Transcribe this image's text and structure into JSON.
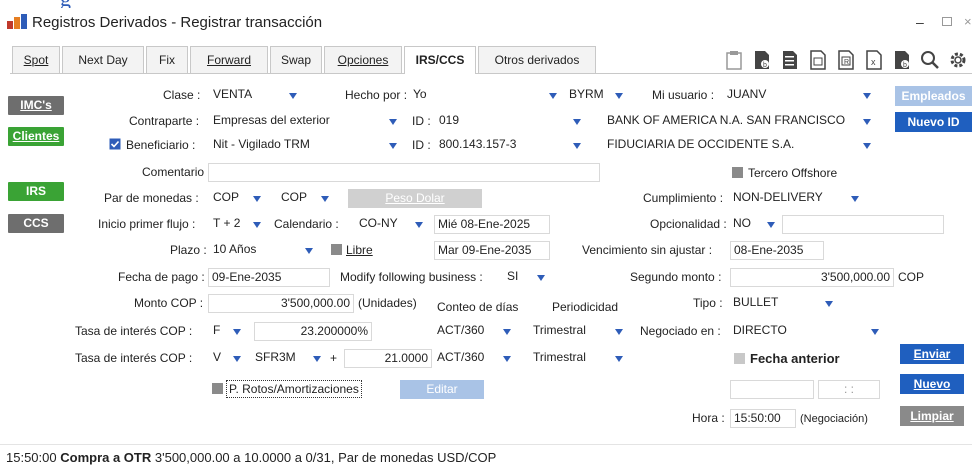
{
  "window": {
    "title": "Registros Derivados - Registrar transacción"
  },
  "tabs": [
    {
      "label": "Spot"
    },
    {
      "label": "Next Day"
    },
    {
      "label": "Fix"
    },
    {
      "label": "Forward"
    },
    {
      "label": "Swap"
    },
    {
      "label": "Opciones"
    },
    {
      "label": "IRS/CCS"
    },
    {
      "label": "Otros derivados"
    }
  ],
  "side": {
    "imcs": "IMC's",
    "clientes": "Clientes",
    "irs": "IRS",
    "ccs": "CCS"
  },
  "form": {
    "clase_label": "Clase :",
    "clase": "VENTA",
    "hecho_por_label": "Hecho por :",
    "hecho_por": "Yo",
    "hecho_por_code": "BYRM",
    "mi_usuario_label": "Mi usuario :",
    "mi_usuario": "JUANV",
    "contraparte_label": "Contraparte :",
    "contraparte": "Empresas del exterior",
    "id1_label": "ID :",
    "id1": "019",
    "contraparte_name": "BANK OF AMERICA N.A. SAN FRANCISCO",
    "beneficiario_label": "Beneficiario :",
    "beneficiario": "Nit - Vigilado TRM",
    "id2_label": "ID :",
    "id2": "800.143.157-3",
    "beneficiario_name": "FIDUCIARIA DE OCCIDENTE S.A.",
    "comentario_label": "Comentario :",
    "comentario": "",
    "tercero_label": "Tercero Offshore",
    "par_label": "Par de monedas :",
    "par1": "COP",
    "par2": "COP",
    "peso_dolar": "Peso Dolar",
    "cumplimiento_label": "Cumplimiento :",
    "cumplimiento": "NON-DELIVERY",
    "inicio_label": "Inicio primer flujo :",
    "inicio": "T + 2",
    "calendario_label": "Calendario :",
    "calendario": "CO-NY",
    "calendario_date": "Mié 08-Ene-2025",
    "opcionalidad_label": "Opcionalidad :",
    "opcionalidad": "NO",
    "plazo_label": "Plazo :",
    "plazo": "10 Años",
    "libre_label": "Libre",
    "plazo_date": "Mar 09-Ene-2035",
    "venc_label": "Vencimiento sin ajustar :",
    "venc": "08-Ene-2035",
    "fecha_pago_label": "Fecha de pago :",
    "fecha_pago": "09-Ene-2035",
    "modify_label": "Modify following business :",
    "modify": "SI",
    "segundo_label": "Segundo monto :",
    "segundo": "3'500,000.00",
    "segundo_ccy": "COP",
    "monto_label": "Monto COP :",
    "monto": "3'500,000.00",
    "unidades": "(Unidades)",
    "conteo_label": "Conteo de días",
    "periodicidad_label": "Periodicidad",
    "tipo_label": "Tipo :",
    "tipo": "BULLET",
    "tasa1_label": "Tasa de interés COP :",
    "tasa1_type": "F",
    "tasa1": "23.200000%",
    "tasa1_conteo": "ACT/360",
    "tasa1_period": "Trimestral",
    "negociado_label": "Negociado en :",
    "negociado": "DIRECTO",
    "tasa2_label": "Tasa de interés COP :",
    "tasa2_type": "V",
    "tasa2_index": "SFR3M",
    "plus": "+",
    "tasa2_spread": "21.0000",
    "tasa2_conteo": "ACT/360",
    "tasa2_period": "Trimestral",
    "fecha_anterior_label": "Fecha anterior",
    "rotos_label": "P. Rotos/Amortizaciones",
    "editar": "Editar",
    "time_placeholder": ": :",
    "hora_label": "Hora :",
    "hora": "15:50:00",
    "negociacion": "(Negociación)"
  },
  "buttons": {
    "empleados": "Empleados",
    "nuevo_id": "Nuevo ID",
    "enviar": "Enviar",
    "nuevo": "Nuevo",
    "limpiar": "Limpiar"
  },
  "status": {
    "time": "15:50:00",
    "action": "Compra a OTR",
    "detail": "3'500,000.00 a 10.0000 a 0/31, Par de monedas USD/COP"
  },
  "colors": {
    "accent": "#1f5fbf",
    "green": "#3aa335",
    "gray": "#6e6e6e",
    "dropdown": "#2e5cb8"
  }
}
